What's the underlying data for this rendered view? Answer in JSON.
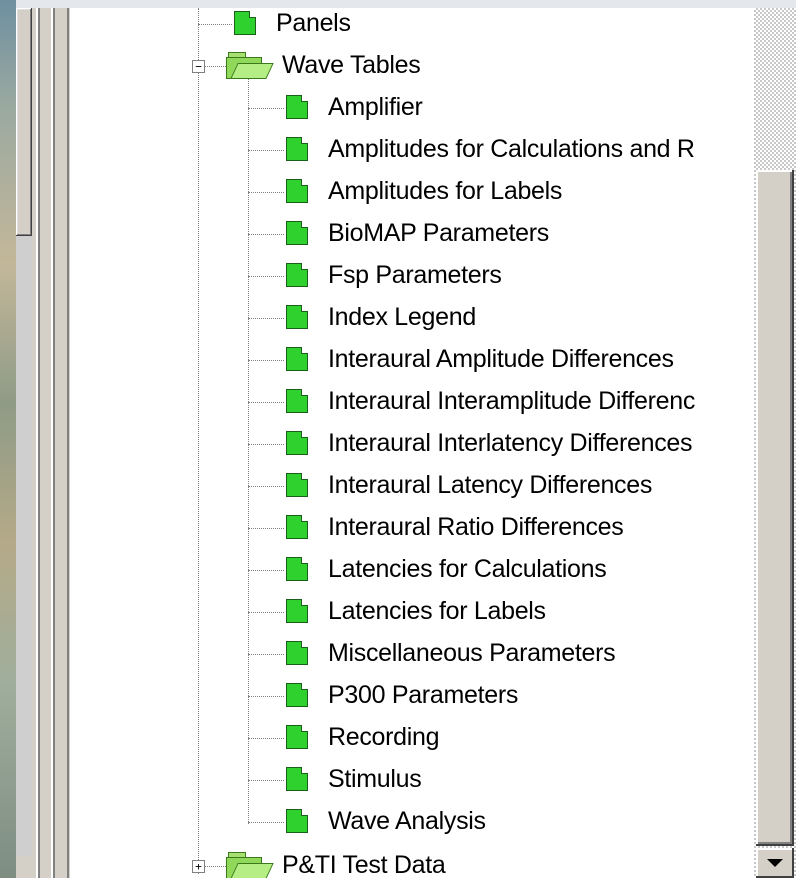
{
  "tree": {
    "top_item": {
      "label": "Panels"
    },
    "wave_tables": {
      "expander": "−",
      "label": "Wave Tables",
      "children": [
        {
          "label": "Amplifier"
        },
        {
          "label": "Amplitudes for Calculations and R"
        },
        {
          "label": "Amplitudes for Labels"
        },
        {
          "label": "BioMAP Parameters"
        },
        {
          "label": "Fsp Parameters"
        },
        {
          "label": "Index Legend"
        },
        {
          "label": "Interaural Amplitude Differences"
        },
        {
          "label": "Interaural Interamplitude Differenc"
        },
        {
          "label": "Interaural Interlatency Differences"
        },
        {
          "label": "Interaural Latency Differences"
        },
        {
          "label": "Interaural Ratio Differences"
        },
        {
          "label": "Latencies for Calculations"
        },
        {
          "label": "Latencies for Labels"
        },
        {
          "label": "Miscellaneous Parameters"
        },
        {
          "label": "P300 Parameters"
        },
        {
          "label": "Recording"
        },
        {
          "label": "Stimulus"
        },
        {
          "label": "Wave Analysis"
        }
      ]
    },
    "next_folder": {
      "expander": "+",
      "label": "P&TI Test Data"
    }
  },
  "icons": {
    "page": "green-page-icon",
    "folder_open": "open-folder-icon",
    "folder_closed": "folder-icon"
  },
  "colors": {
    "page_icon": "#2fd12f",
    "folder_icon": "#8fd85a",
    "panel_bg": "#ffffff",
    "chrome": "#d4d0c8"
  }
}
